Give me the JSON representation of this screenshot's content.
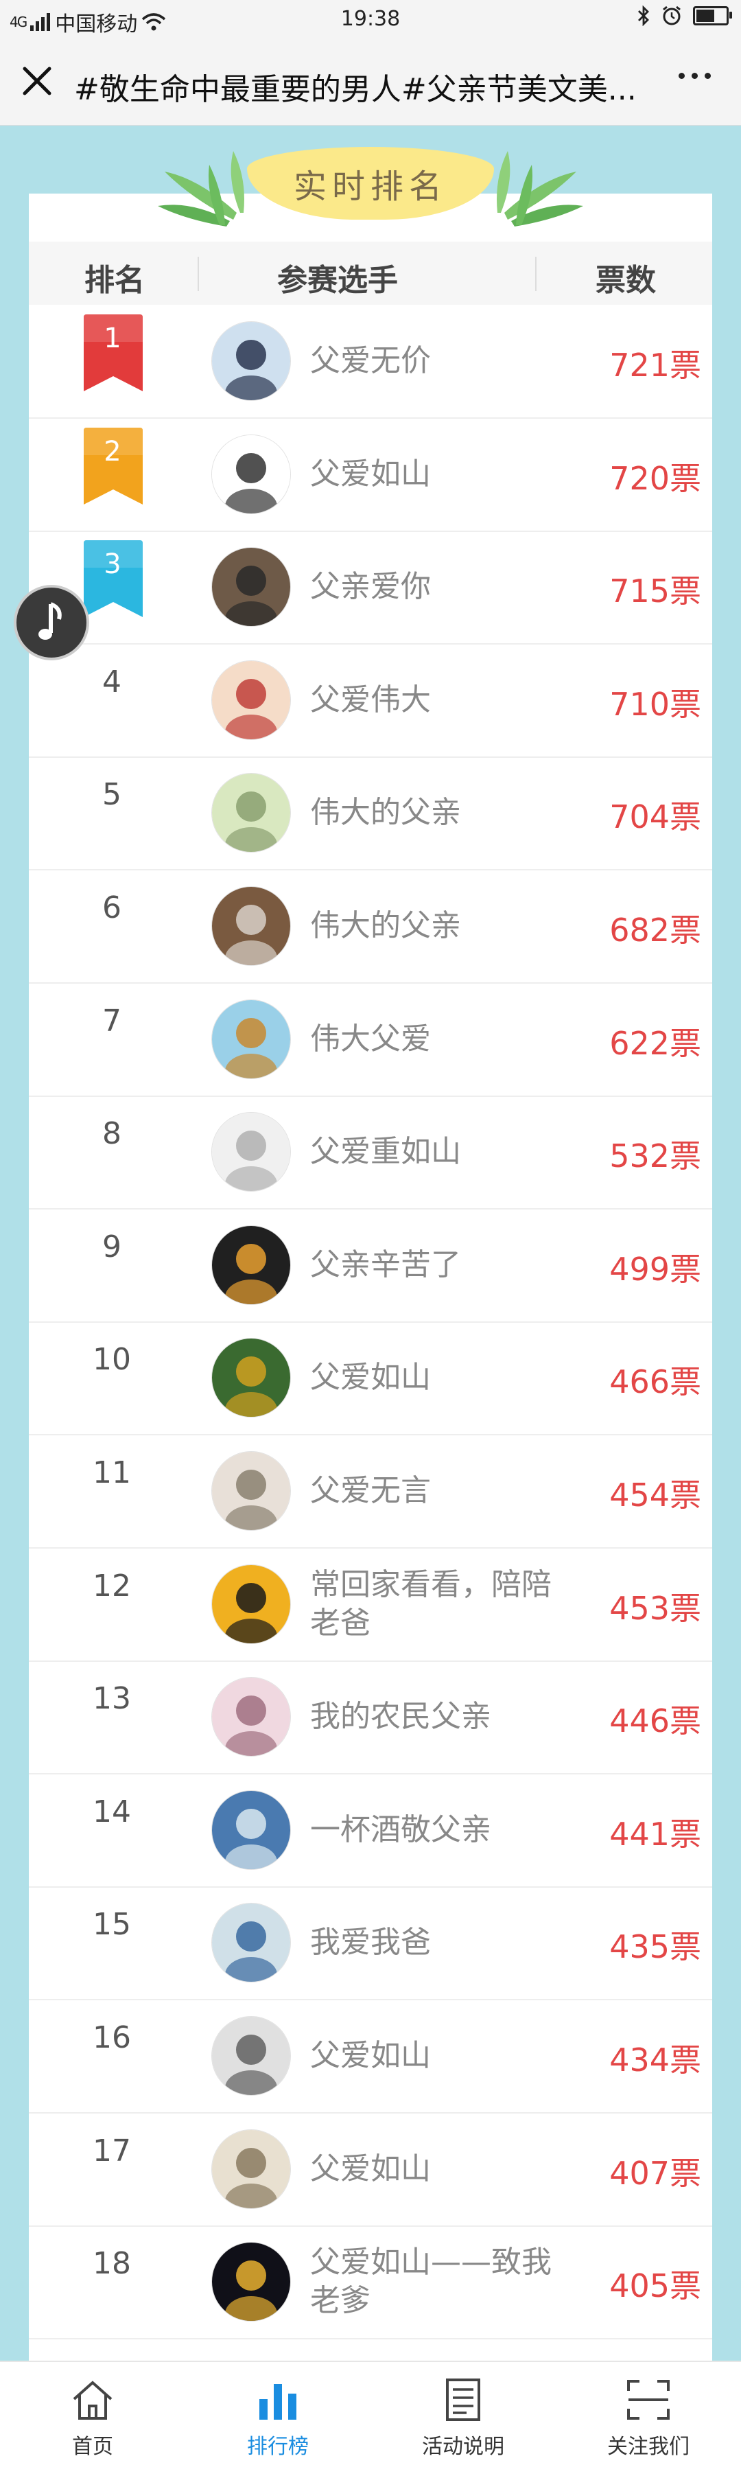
{
  "status_bar": {
    "signal_label": "4G",
    "carrier": "中国移动",
    "time": "19:38",
    "icons": [
      "signal-icon",
      "wifi-icon",
      "bluetooth-icon",
      "alarm-icon",
      "battery-icon"
    ]
  },
  "nav": {
    "title": "#敬生命中最重要的男人#父亲节美文美...",
    "close_icon": "close-icon",
    "more_icon": "more-icon"
  },
  "ranking": {
    "banner_title": "实时排名",
    "columns": {
      "rank": "排名",
      "player": "参赛选手",
      "votes": "票数"
    },
    "medal_colors": [
      "#e23b3b",
      "#f2a31d",
      "#2bb7e0"
    ],
    "rows": [
      {
        "rank": "1",
        "name": "父爱无价",
        "votes": "721票"
      },
      {
        "rank": "2",
        "name": "父爱如山",
        "votes": "720票"
      },
      {
        "rank": "3",
        "name": "父亲爱你",
        "votes": "715票"
      },
      {
        "rank": "4",
        "name": "父爱伟大",
        "votes": "710票"
      },
      {
        "rank": "5",
        "name": "伟大的父亲",
        "votes": "704票"
      },
      {
        "rank": "6",
        "name": "伟大的父亲",
        "votes": "682票"
      },
      {
        "rank": "7",
        "name": "伟大父爱",
        "votes": "622票"
      },
      {
        "rank": "8",
        "name": "父爱重如山",
        "votes": "532票"
      },
      {
        "rank": "9",
        "name": "父亲辛苦了",
        "votes": "499票"
      },
      {
        "rank": "10",
        "name": "父爱如山",
        "votes": "466票"
      },
      {
        "rank": "11",
        "name": "父爱无言",
        "votes": "454票"
      },
      {
        "rank": "12",
        "name": "常回家看看，陪陪老爸",
        "votes": "453票"
      },
      {
        "rank": "13",
        "name": "我的农民父亲",
        "votes": "446票"
      },
      {
        "rank": "14",
        "name": "一杯酒敬父亲",
        "votes": "441票"
      },
      {
        "rank": "15",
        "name": "我爱我爸",
        "votes": "435票"
      },
      {
        "rank": "16",
        "name": "父爱如山",
        "votes": "434票"
      },
      {
        "rank": "17",
        "name": "父爱如山",
        "votes": "407票"
      },
      {
        "rank": "18",
        "name": "父爱如山——致我老爹",
        "votes": "405票"
      }
    ]
  },
  "music_button": {
    "icon": "music-note-icon"
  },
  "tab_bar": {
    "active_color": "#1a8de0",
    "tabs": [
      {
        "label": "首页",
        "icon": "home-icon"
      },
      {
        "label": "排行榜",
        "icon": "bar-chart-icon"
      },
      {
        "label": "活动说明",
        "icon": "document-icon"
      },
      {
        "label": "关注我们",
        "icon": "scan-icon"
      }
    ]
  }
}
